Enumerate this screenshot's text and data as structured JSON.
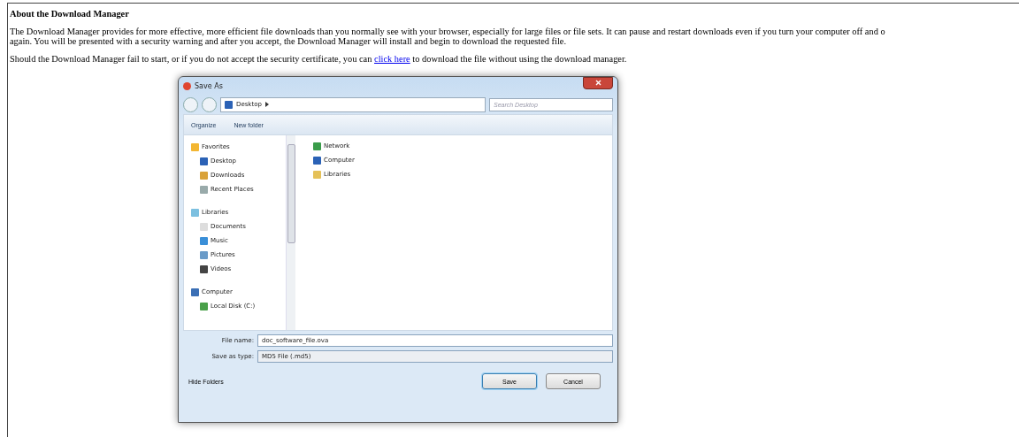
{
  "article": {
    "heading": "About the Download Manager",
    "paragraph_lines": [
      "The Download Manager provides for more effective, more efficient file downloads than you normally see with your browser, especially for large files or file sets. It can pause and restart downloads even if you turn your computer off and o",
      "again. You will be presented with a security warning and after you accept, the Download Manager will install and begin to download the requested file."
    ],
    "fallback": {
      "before": "Should the Download Manager fail to start, or if you do not accept the security certificate, you can",
      "link": "click here",
      "after": "to download the file without using the download manager."
    }
  },
  "dialog": {
    "title": "Save As",
    "address": "Desktop",
    "search": {
      "placeholder": "Search Desktop"
    },
    "toolbar": [
      "Organize",
      "New folder"
    ],
    "nav": [
      {
        "label": "Favorites",
        "children": [
          {
            "label": "Desktop"
          },
          {
            "label": "Downloads"
          },
          {
            "label": "Recent Places"
          }
        ]
      },
      {
        "label": "Libraries",
        "children": [
          {
            "label": "Documents"
          },
          {
            "label": "Music"
          },
          {
            "label": "Pictures"
          },
          {
            "label": "Videos"
          }
        ]
      },
      {
        "label": "Computer",
        "children": [
          {
            "label": "Local Disk (C:)"
          }
        ]
      }
    ],
    "items": [
      "Network",
      "Computer",
      "Libraries"
    ],
    "file_name": {
      "label": "File name:",
      "value": "doc_software_file.ova"
    },
    "save_type": {
      "label": "Save as type:",
      "value": "MD5 File (.md5)"
    },
    "hide_folders": "Hide Folders",
    "buttons": [
      {
        "label": "Save",
        "default": true
      },
      {
        "label": "Cancel",
        "default": false
      }
    ]
  }
}
